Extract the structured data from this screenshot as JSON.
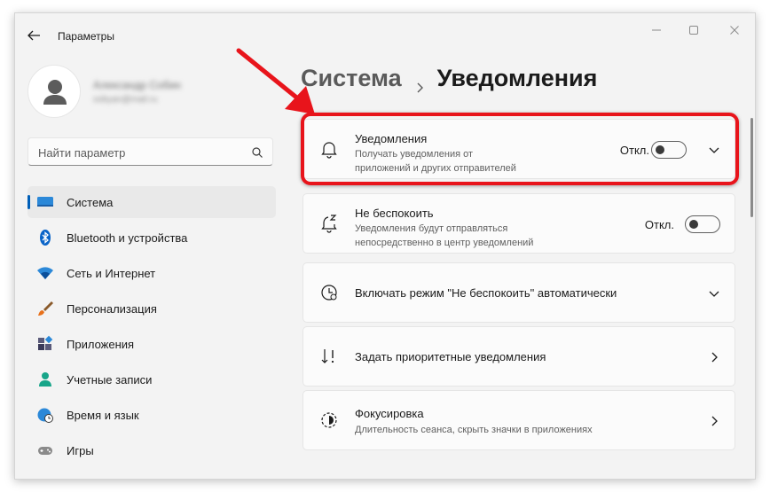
{
  "window": {
    "title": "Параметры"
  },
  "profile": {
    "name": "Александр Собин",
    "email": "sobyan@mail.ru"
  },
  "search": {
    "placeholder": "Найти параметр"
  },
  "sidebar": {
    "items": [
      {
        "label": "Система",
        "icon": "display-icon",
        "active": true
      },
      {
        "label": "Bluetooth и устройства",
        "icon": "bluetooth-icon"
      },
      {
        "label": "Сеть и Интернет",
        "icon": "wifi-icon"
      },
      {
        "label": "Персонализация",
        "icon": "brush-icon"
      },
      {
        "label": "Приложения",
        "icon": "apps-icon"
      },
      {
        "label": "Учетные записи",
        "icon": "person-icon"
      },
      {
        "label": "Время и язык",
        "icon": "globe-clock-icon"
      },
      {
        "label": "Игры",
        "icon": "gamepad-icon"
      }
    ]
  },
  "breadcrumb": {
    "parent": "Система",
    "current": "Уведомления"
  },
  "cards": {
    "notifications": {
      "title": "Уведомления",
      "desc_line1": "Получать уведомления от",
      "desc_line2": "приложений и других отправителей",
      "status": "Откл.",
      "toggle_on": false
    },
    "dnd": {
      "title": "Не беспокоить",
      "desc_line1": "Уведомления будут отправляться",
      "desc_line2": "непосредственно в центр уведомлений",
      "status": "Откл.",
      "toggle_on": false
    },
    "auto_dnd": {
      "title": "Включать режим \"Не беспокоить\" автоматически"
    },
    "priority": {
      "title": "Задать приоритетные уведомления"
    },
    "focus": {
      "title": "Фокусировка",
      "desc": "Длительность сеанса, скрыть значки в приложениях"
    }
  },
  "colors": {
    "accent": "#005fb8",
    "annotation": "#e8141b"
  }
}
